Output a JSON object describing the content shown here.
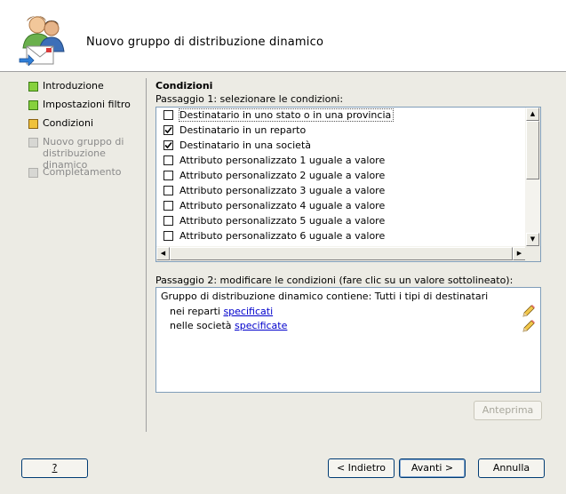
{
  "header": {
    "title": "Nuovo gruppo di distribuzione dinamico"
  },
  "sidebar": {
    "steps": [
      {
        "label": "Introduzione",
        "status": "complete",
        "color": "#86d13d"
      },
      {
        "label": "Impostazioni filtro",
        "status": "complete",
        "color": "#86d13d"
      },
      {
        "label": "Condizioni",
        "status": "current",
        "color": "#f0c23a"
      },
      {
        "label": "Nuovo gruppo di distribuzione dinamico",
        "line1": "Nuovo gruppo di",
        "line2": "distribuzione dinamico",
        "status": "pending"
      },
      {
        "label": "Completamento",
        "status": "pending"
      }
    ]
  },
  "main": {
    "section_title": "Condizioni",
    "step1_label": "Passaggio 1: selezionare le condizioni:",
    "conditions": [
      {
        "label": "Destinatario in uno stato o in una provincia",
        "checked": false
      },
      {
        "label": "Destinatario in un reparto",
        "checked": true
      },
      {
        "label": "Destinatario in una società",
        "checked": true
      },
      {
        "label": "Attributo personalizzato 1 uguale a valore",
        "checked": false
      },
      {
        "label": "Attributo personalizzato 2 uguale a valore",
        "checked": false
      },
      {
        "label": "Attributo personalizzato 3 uguale a valore",
        "checked": false
      },
      {
        "label": "Attributo personalizzato 4 uguale a valore",
        "checked": false
      },
      {
        "label": "Attributo personalizzato 5 uguale a valore",
        "checked": false
      },
      {
        "label": "Attributo personalizzato 6 uguale a valore",
        "checked": false
      }
    ],
    "step2_label": "Passaggio 2: modificare le condizioni (fare clic su un valore sottolineato):",
    "condition_editor": {
      "summary": "Gruppo di distribuzione dinamico contiene: Tutti i tipi di destinatari",
      "line1_prefix": "nei reparti ",
      "line1_link": "specificati",
      "line2_prefix": "nelle società ",
      "line2_link": "specificate"
    },
    "preview_button": "Anteprima"
  },
  "footer": {
    "help_button": "?",
    "back_button": "< Indietro",
    "next_button": "Avanti >",
    "cancel_button": "Annulla"
  },
  "colors": {
    "background": "#ecebe4",
    "link": "#0000cc",
    "border": "#7f9db9",
    "button_border": "#003c74"
  },
  "icons": {
    "header": "users-envelope-icon",
    "edit": "pencil-icon",
    "check": "checkmark-icon"
  }
}
